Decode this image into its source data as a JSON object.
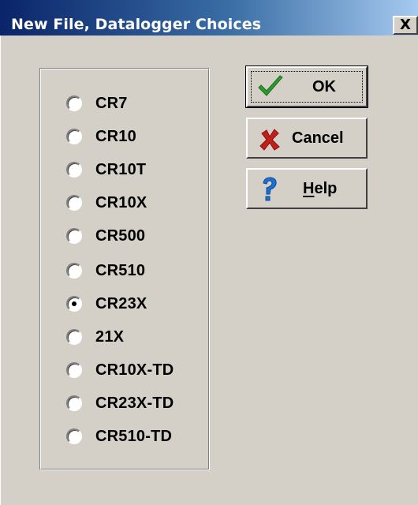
{
  "window": {
    "title": "New File, Datalogger Choices",
    "close_glyph": "X"
  },
  "datalogger_options": [
    {
      "label": "CR7",
      "checked": false
    },
    {
      "label": "CR10",
      "checked": false
    },
    {
      "label": "CR10T",
      "checked": false
    },
    {
      "label": "CR10X",
      "checked": false
    },
    {
      "label": "CR500",
      "checked": false
    },
    {
      "label": "CR510",
      "checked": false
    },
    {
      "label": "CR23X",
      "checked": true
    },
    {
      "label": "21X",
      "checked": false
    },
    {
      "label": "CR10X-TD",
      "checked": false
    },
    {
      "label": "CR23X-TD",
      "checked": false
    },
    {
      "label": "CR510-TD",
      "checked": false
    }
  ],
  "buttons": {
    "ok": {
      "label": "OK",
      "icon": "checkmark-icon",
      "color": "#2e9a2e"
    },
    "cancel": {
      "label": "Cancel",
      "icon": "x-mark-icon",
      "color": "#c0201a"
    },
    "help": {
      "label": "Help",
      "icon": "question-mark-icon",
      "color": "#1e6fd0"
    }
  }
}
